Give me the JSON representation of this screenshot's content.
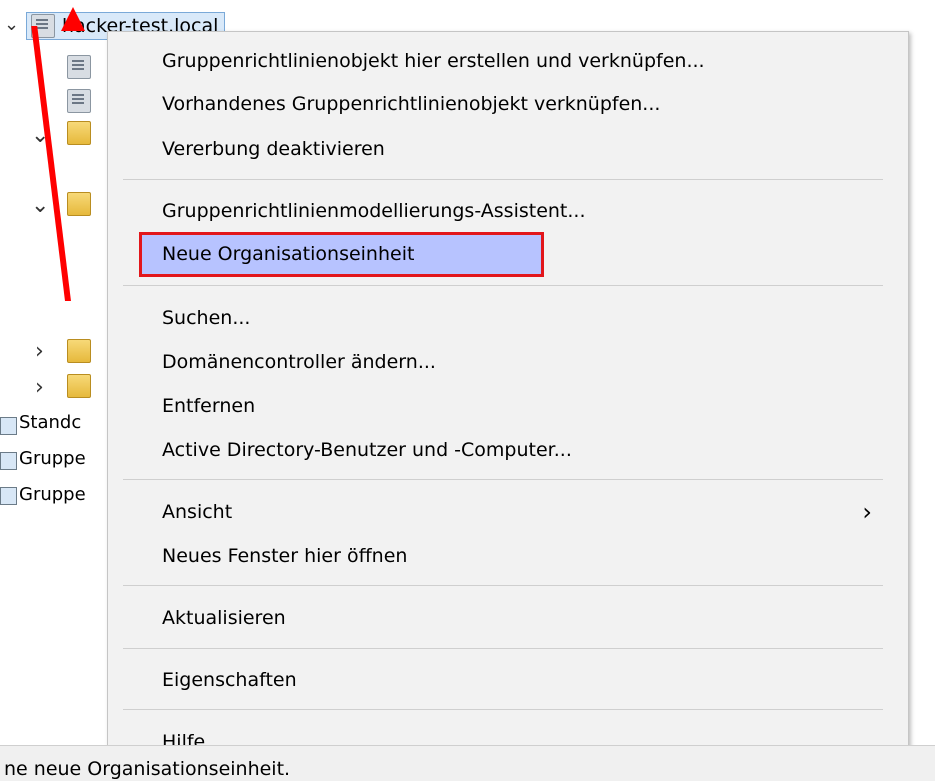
{
  "tree": {
    "root_label": "hacker-test.local",
    "partial_items": [
      "Standc",
      "Gruppe",
      "Gruppe"
    ]
  },
  "context_menu": {
    "items": [
      {
        "label": "Gruppenrichtlinienobjekt hier erstellen und verknüpfen..."
      },
      {
        "label": "Vorhandenes Gruppenrichtlinienobjekt verknüpfen..."
      },
      {
        "label": "Vererbung deaktivieren"
      },
      {
        "label": "Gruppenrichtlinienmodellierungs-Assistent..."
      },
      {
        "label": "Neue Organisationseinheit"
      },
      {
        "label": "Suchen..."
      },
      {
        "label": "Domänencontroller ändern..."
      },
      {
        "label": "Entfernen"
      },
      {
        "label": "Active Directory-Benutzer und -Computer..."
      },
      {
        "label": "Ansicht"
      },
      {
        "label": "Neues Fenster hier öffnen"
      },
      {
        "label": "Aktualisieren"
      },
      {
        "label": "Eigenschaften"
      },
      {
        "label": "Hilfe"
      }
    ],
    "submenu_arrow": "›",
    "highlight_color": "#b7c3ff",
    "highlight_border_color": "#e2161b"
  },
  "statusbar": {
    "text": "ne neue Organisationseinheit."
  },
  "annotation": {
    "arrow_color": "#ff0000"
  }
}
